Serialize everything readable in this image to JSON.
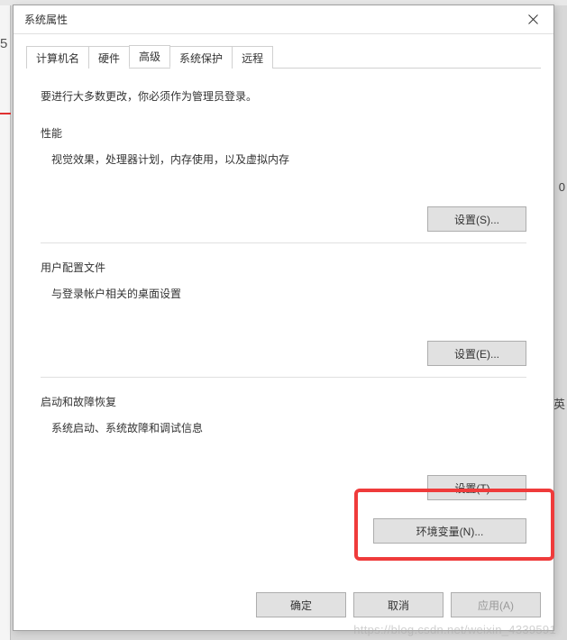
{
  "background": {
    "left_number": "5",
    "right_char_1": "0",
    "right_char_2": "英"
  },
  "dialog": {
    "title": "系统属性",
    "tabs": [
      {
        "label": "计算机名"
      },
      {
        "label": "硬件"
      },
      {
        "label": "高级"
      },
      {
        "label": "系统保护"
      },
      {
        "label": "远程"
      }
    ],
    "active_tab_index": 2,
    "admin_note": "要进行大多数更改，你必须作为管理员登录。",
    "sections": {
      "performance": {
        "title": "性能",
        "desc": "视觉效果，处理器计划，内存使用，以及虚拟内存",
        "button": "设置(S)..."
      },
      "user_profiles": {
        "title": "用户配置文件",
        "desc": "与登录帐户相关的桌面设置",
        "button": "设置(E)..."
      },
      "startup": {
        "title": "启动和故障恢复",
        "desc": "系统启动、系统故障和调试信息",
        "button": "设置(T)..."
      }
    },
    "env_vars_button": "环境变量(N)...",
    "footer": {
      "ok": "确定",
      "cancel": "取消",
      "apply": "应用(A)"
    }
  },
  "watermark": "https://blog.csdn.net/weixin_4339591"
}
